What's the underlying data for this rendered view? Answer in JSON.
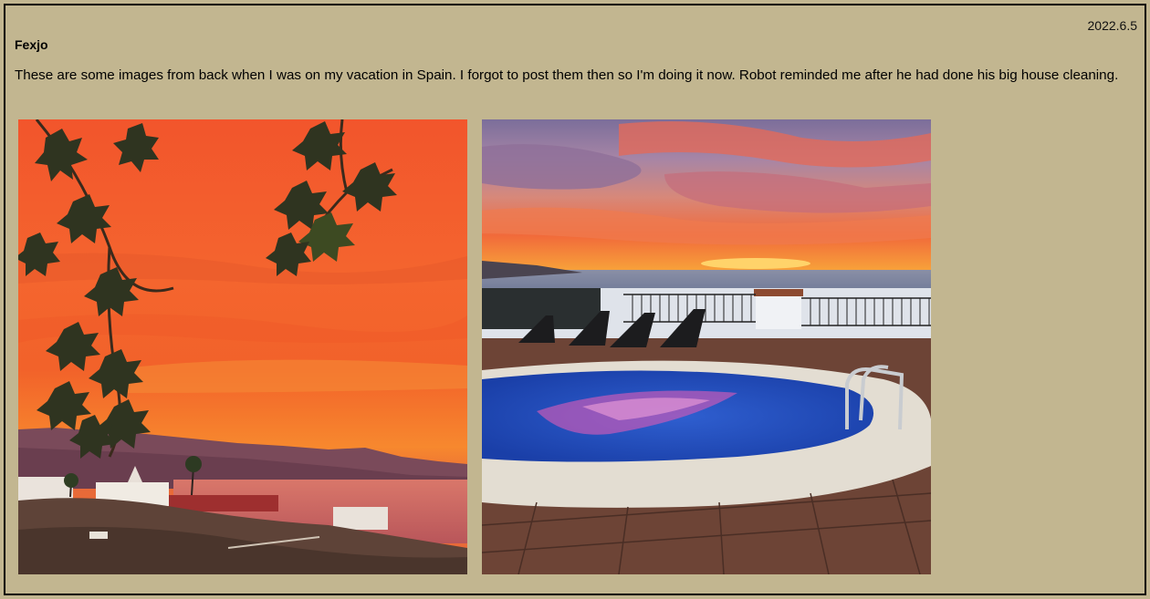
{
  "post": {
    "date": "2022.6.5",
    "author": "Fexjo",
    "text": "These are some images from back when I was on my vacation in Spain. I forgot to post them then so I'm doing it now. Robot reminded me after he had done his big house cleaning."
  },
  "photos": [
    {
      "name": "sunset-coast-photo"
    },
    {
      "name": "sunset-pool-photo"
    }
  ],
  "colors": {
    "background": "#c2b690",
    "border": "#000000"
  }
}
